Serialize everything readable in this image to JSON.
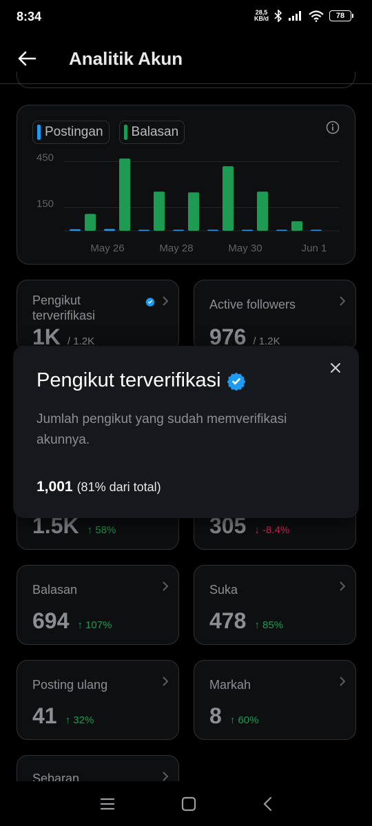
{
  "status_bar": {
    "time": "8:34",
    "net_speed_value": "28,5",
    "net_speed_unit": "KB/d",
    "battery": "78"
  },
  "header": {
    "title": "Analitik Akun"
  },
  "chart": {
    "legend": [
      {
        "label": "Postingan",
        "color": "#1d9bf0"
      },
      {
        "label": "Balasan",
        "color": "#1d9b53"
      }
    ]
  },
  "chart_data": {
    "type": "bar",
    "categories": [
      "May 25",
      "May 26",
      "May 27",
      "May 28",
      "May 29",
      "May 30",
      "May 31",
      "Jun 1"
    ],
    "x_tick_labels": [
      "May 26",
      "May 28",
      "May 30",
      "Jun 1"
    ],
    "y_tick_labels": [
      "450",
      "150"
    ],
    "ylim": [
      0,
      520
    ],
    "grid": true,
    "legend_position": "top-left",
    "series": [
      {
        "name": "Postingan",
        "color": "#1d9bf0",
        "values": [
          10,
          12,
          3,
          4,
          6,
          5,
          7,
          3
        ]
      },
      {
        "name": "Balasan",
        "color": "#1d9b53",
        "values": [
          110,
          470,
          255,
          250,
          420,
          255,
          62,
          0
        ]
      }
    ]
  },
  "cards": {
    "verified_followers": {
      "label": "Pengikut terverifikasi",
      "value": "1K",
      "sub": "/ 1.2K"
    },
    "active_followers": {
      "label": "Active followers",
      "value": "976",
      "sub": "/ 1.2K"
    },
    "hidden_left": {
      "value": "1.5K",
      "delta": "↑ 58%"
    },
    "hidden_right": {
      "value": "305",
      "delta": "↓ -8.4%"
    },
    "replies": {
      "label": "Balasan",
      "value": "694",
      "delta": "↑ 107%"
    },
    "likes": {
      "label": "Suka",
      "value": "478",
      "delta": "↑ 85%"
    },
    "reposts": {
      "label": "Posting ulang",
      "value": "41",
      "delta": "↑ 32%"
    },
    "bookmarks": {
      "label": "Markah",
      "value": "8",
      "delta": "↑ 60%"
    },
    "distribution": {
      "label": "Sebaran"
    }
  },
  "popup": {
    "title": "Pengikut terverifikasi",
    "description": "Jumlah pengikut yang sudah memverifikasi akunnya.",
    "count": "1,001",
    "percent_text": "(81% dari total)"
  },
  "colors": {
    "background": "#000000",
    "card": "#0e0f11",
    "border": "#2f3336",
    "verified_blue": "#1d9bf0",
    "up_green": "#1d9b53",
    "down_red": "#e0245e"
  }
}
